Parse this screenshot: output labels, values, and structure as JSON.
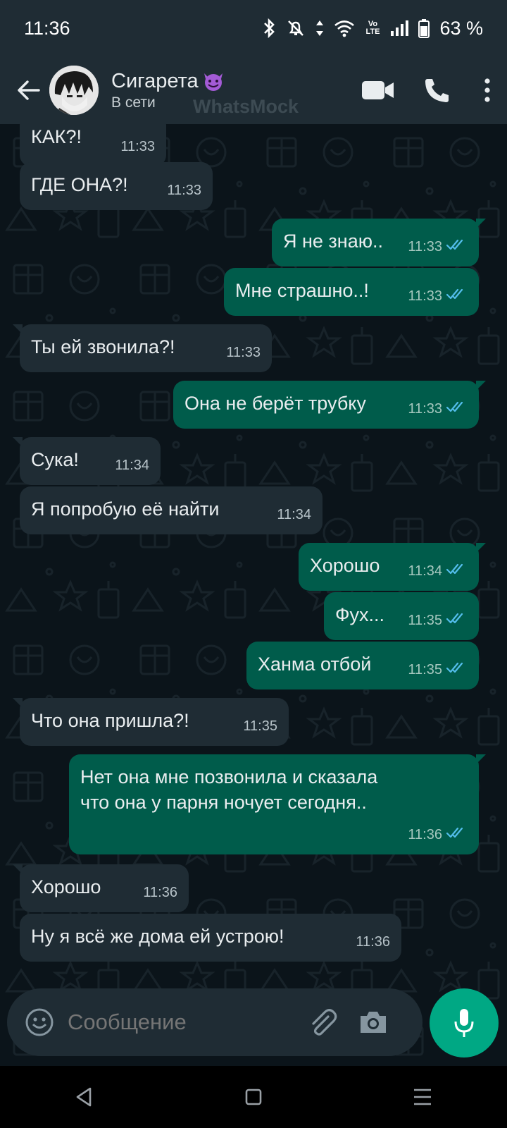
{
  "status_bar": {
    "time": "11:36",
    "battery_percent": "63 %",
    "network_label": "Vo LTE"
  },
  "header": {
    "contact_name": "Сигарета",
    "contact_emoji": "smiling-devil-emoji",
    "contact_status": "В сети",
    "watermark": "WhatsMock"
  },
  "messages": [
    {
      "dir": "in",
      "text": "КАК?!",
      "time": "11:33"
    },
    {
      "dir": "in",
      "text": "ГДЕ ОНА?!",
      "time": "11:33"
    },
    {
      "dir": "out",
      "text": "Я не знаю..",
      "time": "11:33",
      "read": true
    },
    {
      "dir": "out",
      "text": "Мне страшно..!",
      "time": "11:33",
      "read": true
    },
    {
      "dir": "in",
      "text": "Ты ей звонила?!",
      "time": "11:33"
    },
    {
      "dir": "out",
      "text": "Она не берёт трубку",
      "time": "11:33",
      "read": true
    },
    {
      "dir": "in",
      "text": "Сука!",
      "time": "11:34"
    },
    {
      "dir": "in",
      "text": "Я попробую её найти",
      "time": "11:34"
    },
    {
      "dir": "out",
      "text": "Хорошо",
      "time": "11:34",
      "read": true
    },
    {
      "dir": "out",
      "text": "Фух...",
      "time": "11:35",
      "read": true
    },
    {
      "dir": "out",
      "text": "Ханма отбой",
      "time": "11:35",
      "read": true
    },
    {
      "dir": "in",
      "text": "Что она пришла?!",
      "time": "11:35"
    },
    {
      "dir": "out",
      "text": "Нет она мне позвонила и сказала\nчто она у парня ночует сегодня..",
      "time": "11:36",
      "read": true
    },
    {
      "dir": "in",
      "text": "Хорошо",
      "time": "11:36"
    },
    {
      "dir": "in",
      "text": "Ну я всё же дома ей устрою!",
      "time": "11:36"
    }
  ],
  "composer": {
    "placeholder": "Сообщение"
  },
  "colors": {
    "incoming_bubble": "#1f2c34",
    "outgoing_bubble": "#005c4b",
    "accent": "#00a884",
    "read_tick": "#53bdeb"
  }
}
